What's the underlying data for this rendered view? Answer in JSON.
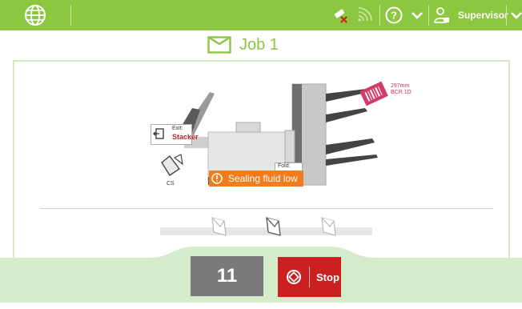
{
  "colors": {
    "accent": "#8dc63f",
    "alert": "#f07c1e",
    "stop": "#cc1f1f",
    "counter_bg": "#7a7a7a"
  },
  "header": {
    "logo_icon": "globe-icon",
    "icons": [
      "ink-cartridge-warning-icon",
      "wireless-signal-icon",
      "help-icon",
      "chevron-down-icon",
      "user-icon",
      "chevron-down-icon"
    ],
    "user_label": "Supervisor"
  },
  "job": {
    "icon": "envelope-icon",
    "title": "Job 1"
  },
  "machine": {
    "exit_label": "Exit:",
    "exit_value": "Stacker",
    "fold_label": "Fold:",
    "cs_label": "CS",
    "barcode_size": "297mm",
    "barcode_type": "BCR 1D"
  },
  "alert": {
    "icon": "alert-icon",
    "text": "Sealing fluid low"
  },
  "counter": {
    "value": "11"
  },
  "stop": {
    "icon": "stop-icon",
    "label": "Stop"
  }
}
